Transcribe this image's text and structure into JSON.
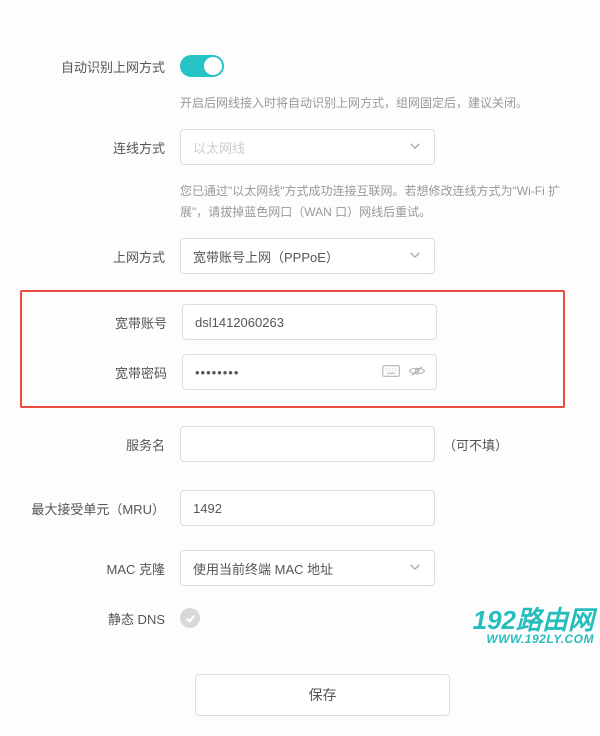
{
  "auto_detect": {
    "label": "自动识别上网方式",
    "enabled": true,
    "hint": "开启后网线接入时将自动识别上网方式，组网固定后，建议关闭。"
  },
  "connection_mode": {
    "label": "连线方式",
    "value": "以太网线",
    "hint": "您已通过\"以太网线\"方式成功连接互联网。若想修改连线方式为\"Wi-Fi 扩展\"，请拔掉蓝色网口（WAN 口）网线后重试。"
  },
  "internet_mode": {
    "label": "上网方式",
    "value": "宽带账号上网（PPPoE）"
  },
  "broadband_account": {
    "label": "宽带账号",
    "value": "dsl1412060263"
  },
  "broadband_password": {
    "label": "宽带密码",
    "value": "••••••••"
  },
  "service_name": {
    "label": "服务名",
    "value": "",
    "suffix": "（可不填）"
  },
  "mru": {
    "label": "最大接受单元（MRU）",
    "value": "1492"
  },
  "mac_clone": {
    "label": "MAC 克隆",
    "value": "使用当前终端 MAC 地址"
  },
  "static_dns": {
    "label": "静态 DNS",
    "checked": true
  },
  "save_button": "保存",
  "watermark": {
    "main": "192路由网",
    "sub": "WWW.192LY.COM"
  }
}
